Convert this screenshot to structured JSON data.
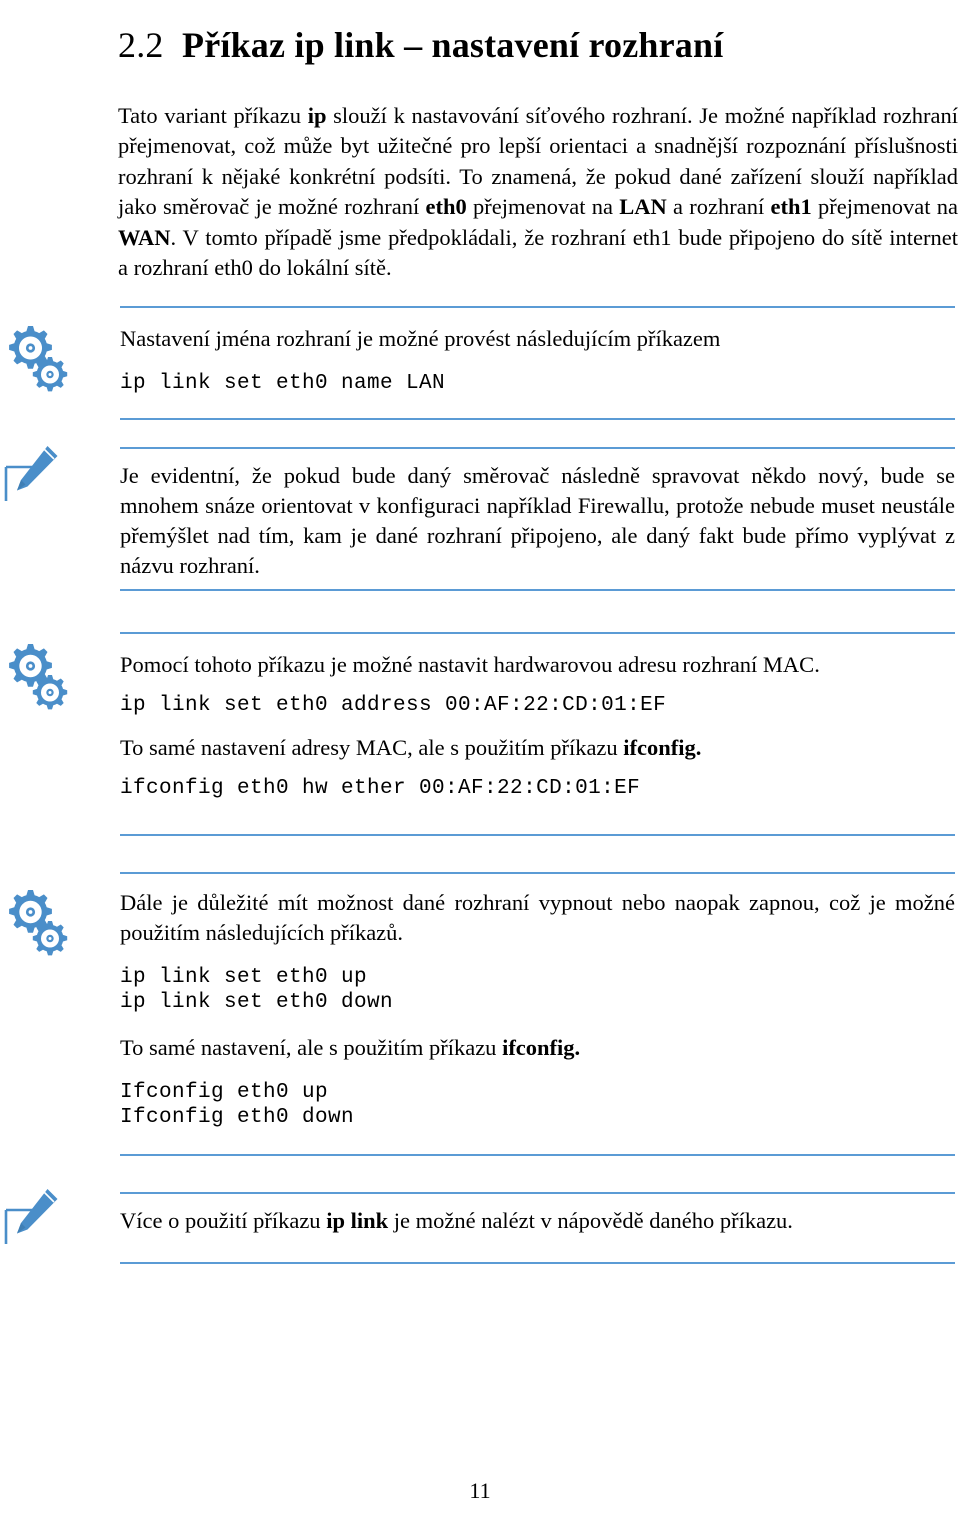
{
  "colors": {
    "accent_blue": "#5b9bd5",
    "text": "#000000",
    "page_background": "#ffffff"
  },
  "heading": {
    "number": "2.2",
    "prefix": "Příkaz ",
    "command": "ip link",
    "suffix": " – nastavení rozhraní"
  },
  "intro_paragraph": {
    "p1": "Tato variant příkazu ",
    "b1": "ip",
    "p2": " slouží k nastavování síťového rozhraní. Je možné například rozhraní přejmenovat, což může byt užitečné pro lepší orientaci a snadnější rozpoznání příslušnosti rozhraní k nějaké konkrétní podsíti. To znamená, že pokud dané zařízení slouží například jako směrovač je možné rozhraní ",
    "b2": "eth0",
    "p3": " přejmenovat na ",
    "b3": "LAN",
    "p4": " a rozhraní ",
    "b4": "eth1",
    "p5": " přejmenovat na ",
    "b5": "WAN",
    "p6": ". V tomto případě jsme předpokládali, že rozhraní eth1 bude připojeno do sítě internet a rozhraní eth0 do lokální sítě."
  },
  "callouts": [
    {
      "id": "callout-rename",
      "icon": "gears-icon",
      "lines": [
        {
          "type": "text",
          "value": "Nastavení jména rozhraní je možné provést následujícím příkazem"
        },
        {
          "type": "code",
          "value": "ip link set eth0 name LAN"
        }
      ]
    },
    {
      "id": "callout-note-1",
      "icon": "pencil-icon",
      "lines": [
        {
          "type": "text",
          "value": "Je evidentní, že pokud bude daný směrovač následně spravovat někdo nový, bude se mnohem snáze orientovat v konfiguraci například Firewallu, protože nebude muset neustále přemýšlet nad tím, kam je dané rozhraní připojeno, ale daný fakt bude přímo vyplývat z názvu rozhraní."
        }
      ]
    },
    {
      "id": "callout-mac",
      "icon": "gears-icon",
      "lines": [
        {
          "type": "text",
          "value": "Pomocí tohoto příkazu je možné nastavit hardwarovou adresu rozhraní MAC."
        },
        {
          "type": "code",
          "value": "ip link set eth0 address 00:AF:22:CD:01:EF"
        },
        {
          "type": "text_bold_tail",
          "value": "To samé nastavení adresy MAC, ale s použitím příkazu ",
          "bold": "ifconfig."
        },
        {
          "type": "code",
          "value": "ifconfig eth0 hw ether 00:AF:22:CD:01:EF"
        }
      ]
    },
    {
      "id": "callout-updown",
      "icon": "gears-icon",
      "lines": [
        {
          "type": "text",
          "value": "Dále je důležité mít možnost dané rozhraní vypnout nebo naopak zapnou, což je možné použitím následujících příkazů."
        },
        {
          "type": "code",
          "value": "ip link set eth0 up"
        },
        {
          "type": "code",
          "value": "ip link set eth0 down"
        },
        {
          "type": "text_bold_tail",
          "value": "To samé nastavení, ale s použitím příkazu ",
          "bold": "ifconfig."
        },
        {
          "type": "code",
          "value": "Ifconfig eth0 up"
        },
        {
          "type": "code",
          "value": "Ifconfig eth0 down"
        }
      ]
    },
    {
      "id": "callout-note-2",
      "icon": "pencil-icon",
      "lines": [
        {
          "type": "text_with_bold_mid",
          "pre": "Více o použití příkazu ",
          "bold": "ip link",
          "post": " je možné nalézt v nápovědě daného příkazu."
        }
      ]
    }
  ],
  "footer": {
    "page_number": "11"
  }
}
